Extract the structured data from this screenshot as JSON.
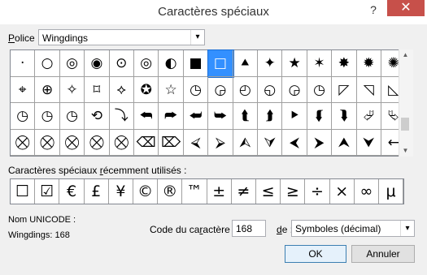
{
  "window": {
    "title": "Caractères spéciaux",
    "help": "?",
    "close": "✕"
  },
  "font": {
    "label_prefix": "",
    "label_u": "P",
    "label_rest": "olice :",
    "value": "Wingdings"
  },
  "grid": {
    "rows": [
      [
        "·",
        "○",
        "◎",
        "◉",
        "⊙",
        "◎",
        "◐",
        "■",
        "□",
        "⯅",
        "✦",
        "★",
        "✶",
        "✸",
        "✹",
        "✺"
      ],
      [
        "⌖",
        "⊕",
        "✧",
        "⌑",
        "⟡",
        "✪",
        "☆",
        "◷",
        "◶",
        "◴",
        "◵",
        "◶",
        "◷",
        "◸",
        "◹",
        "◺"
      ],
      [
        "◷",
        "◷",
        "◷",
        "⟲",
        "⤵",
        "⮪",
        "⮫",
        "⮨",
        "⮩",
        "⮬",
        "⮭",
        "⯈",
        "⮮",
        "⮯",
        "⮰",
        "⮱"
      ],
      [
        "⛒",
        "⛒",
        "⛒",
        "⛒",
        "⛒",
        "⌫",
        "⌦",
        "⮘",
        "⮚",
        "⮙",
        "⮛",
        "⮜",
        "⮞",
        "⮝",
        "⮟",
        "←"
      ]
    ],
    "selected_row": 0,
    "selected_col": 8
  },
  "recent": {
    "label": "Caractères spéciaux récemment utilisés :",
    "label_pre": "Caractères spéciaux ",
    "label_u": "r",
    "label_post": "écemment utilisés :",
    "chars": [
      "☐",
      "☑",
      "€",
      "£",
      "¥",
      "©",
      "®",
      "™",
      "±",
      "≠",
      "≤",
      "≥",
      "÷",
      "×",
      "∞",
      "μ"
    ]
  },
  "unicode_name": "Nom UNICODE :",
  "char_name": "Wingdings: 168",
  "code": {
    "label_pre": "Code du ca",
    "label_u": "r",
    "label_post": "actère :",
    "value": "168"
  },
  "de": {
    "label_u": "d",
    "label_rest": "e :"
  },
  "encoding": {
    "value": "Symboles (décimal)"
  },
  "buttons": {
    "ok": "OK",
    "cancel": "Annuler"
  }
}
